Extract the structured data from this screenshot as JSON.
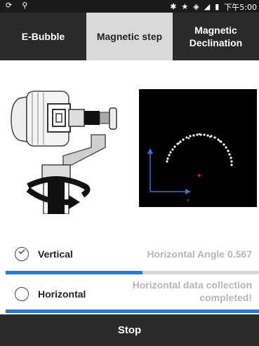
{
  "status_bar": {
    "left_icons": [
      "sync-icon",
      "location-icon"
    ],
    "right_icons": [
      "bluetooth-icon",
      "star-icon",
      "wifi-icon",
      "signal-icon",
      "battery-icon"
    ],
    "time": "下午5:00"
  },
  "tabs": [
    {
      "label": "E-Bubble",
      "active": false
    },
    {
      "label": "Magnetic step",
      "active": true
    },
    {
      "label": "Magnetic Declination",
      "active": false
    }
  ],
  "rows": {
    "vertical": {
      "label": "Vertical",
      "status": "Horizontal Angle 0.567",
      "checked": true,
      "progress": 0.54
    },
    "horizontal": {
      "label": "Horizontal",
      "status": "Horizontal data collection completed!",
      "checked": false,
      "progress": 1.0
    }
  },
  "stop_button": {
    "label": "Stop"
  },
  "colors": {
    "accent_blue": "#2b78d1",
    "dark_bar": "#2a2a2a",
    "active_tab": "#d9d9d9",
    "muted_text": "#b5b5b5"
  }
}
